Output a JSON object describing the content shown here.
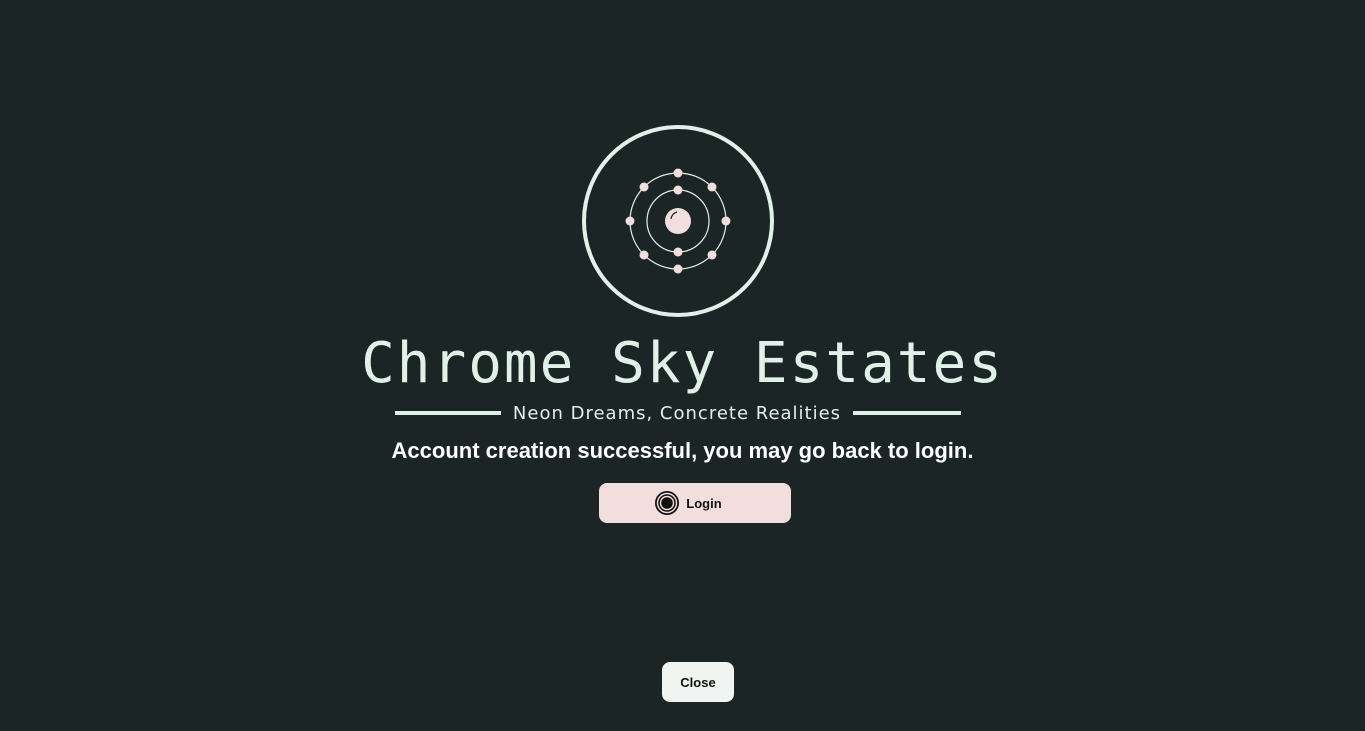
{
  "brand": {
    "title": "Chrome Sky Estates",
    "tagline": "Neon Dreams, Concrete Realities",
    "logo_icon": "atom-orbit-icon"
  },
  "message": {
    "text": "Account creation successful, you may go back to login."
  },
  "login_button": {
    "label": "Login",
    "icon": "target-icon"
  },
  "close_button": {
    "label": "Close"
  },
  "colors": {
    "background": "#1b2526",
    "accent_mint": "#e0f2e7",
    "accent_pink": "#f2dfdd",
    "close_bg": "#f0f5f1"
  }
}
